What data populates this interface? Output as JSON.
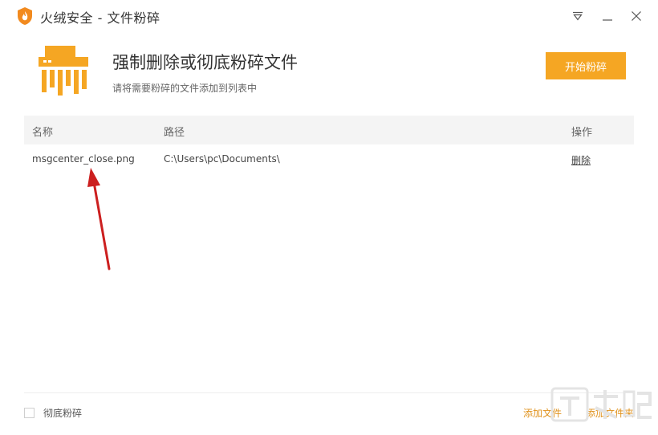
{
  "window": {
    "title": "火绒安全 - 文件粉碎",
    "logo_icon": "huorong-flame-shield-icon",
    "controls": [
      "menu-triangle-icon",
      "minimize-icon",
      "close-icon"
    ]
  },
  "header": {
    "icon": "shredder-icon",
    "title": "强制删除或彻底粉碎文件",
    "subtitle": "请将需要粉碎的文件添加到列表中",
    "start_button": "开始粉碎"
  },
  "table": {
    "columns": [
      "名称",
      "路径",
      "操作"
    ],
    "rows": [
      {
        "name": "msgcenter_close.png",
        "path": "C:\\Users\\pc\\Documents\\",
        "action": "删除"
      }
    ]
  },
  "footer": {
    "checkbox_label": "彻底粉碎",
    "checkbox_checked": false,
    "add_file": "添加文件",
    "add_folder": "添加文件夹"
  },
  "colors": {
    "accent": "#f5a623",
    "link": "#e0921c",
    "annotation_arrow": "#cc1f1f"
  }
}
